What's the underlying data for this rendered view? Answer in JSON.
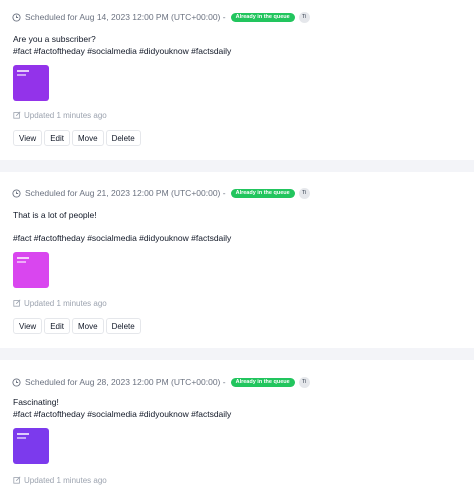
{
  "posts": [
    {
      "scheduled": "Scheduled for Aug 14, 2023 12:00 PM (UTC+00:00) -",
      "status": "Already in the queue",
      "account": "Ti",
      "text1": "Are you a subscriber?",
      "text2": "",
      "hashtags": "#fact #factoftheday #socialmedia #didyouknow #factsdaily",
      "thumb_color": "#9333ea",
      "updated": "Updated 1 minutes ago"
    },
    {
      "scheduled": "Scheduled for Aug 21, 2023 12:00 PM (UTC+00:00) -",
      "status": "Already in the queue",
      "account": "Ti",
      "text1": "That is a lot of people!",
      "text2": "",
      "hashtags": "#fact #factoftheday #socialmedia #didyouknow #factsdaily",
      "thumb_color": "#d946ef",
      "updated": "Updated 1 minutes ago"
    },
    {
      "scheduled": "Scheduled for Aug 28, 2023 12:00 PM (UTC+00:00) -",
      "status": "Already in the queue",
      "account": "Ti",
      "text1": "Fascinating!",
      "text2": "",
      "hashtags": "#fact #factoftheday #socialmedia #didyouknow #factsdaily",
      "thumb_color": "#7c3aed",
      "updated": "Updated 1 minutes ago"
    }
  ],
  "actions": {
    "view": "View",
    "edit": "Edit",
    "move": "Move",
    "delete": "Delete"
  },
  "colors": {
    "badge_bg": "#22c55e",
    "separator": "#f3f4f8"
  },
  "icons": {
    "schedule": "clock-icon",
    "updated": "edit-icon"
  }
}
